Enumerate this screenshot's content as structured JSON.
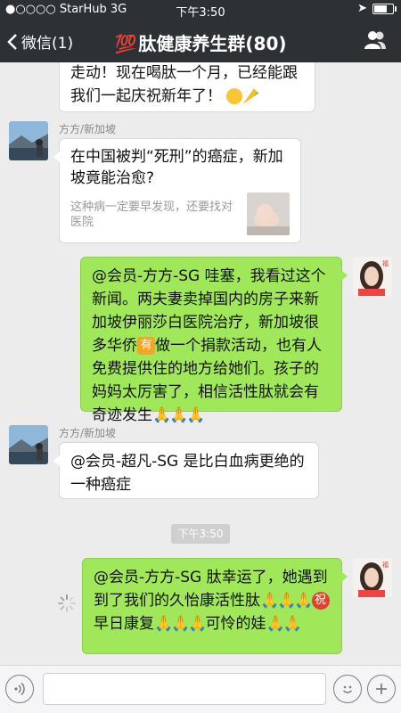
{
  "status_bar": {
    "carrier": "●○○○○ StarHub  3G",
    "time": "下午3:50"
  },
  "nav": {
    "back_label": "微信(1)",
    "title_emoji": "💯",
    "title": "肽健康养生群(80)"
  },
  "messages": [
    {
      "text": "走动！现在喝肽一个月，已经能跟我们一起庆祝新年了！"
    },
    {
      "sender": "方方/新加坡",
      "card_title": "在中国被判“死刑”的癌症，新加坡竟能治愈?",
      "card_desc": "这种病一定要早发现，还要找对医院"
    },
    {
      "text_1": "@会员-方方-SG 哇塞，我看过这个新闻。两夫妻卖掉国内的房子来新加坡伊丽莎白医院治疗，新加坡很多华侨",
      "emoji_have": "有",
      "text_2": "做一个捐款活动，也有人免费提供住的地方给她们。孩子的妈妈太厉害了，相信活性肽就会有奇迹发生",
      "pray": "🙏🙏🙏"
    },
    {
      "sender": "方方/新加坡",
      "text": "@会员-超凡-SG 是比白血病更绝的一种癌症"
    },
    {
      "text_1": "@会员-方方-SG 肽幸运了，她遇到到了我们的久怡康活性肽",
      "pray_1": "🙏🙏🙏",
      "emoji_bless": "祝",
      "text_2": "早日康复",
      "pray_2": "🙏🙏🙏",
      "text_3": "可怜的娃",
      "pray_3": "🙏🙏"
    }
  ],
  "timestamp": "下午3:50",
  "colors": {
    "nav_bg": "#2e3134",
    "chat_bg": "#ececec",
    "green_bubble": "#a0e75a",
    "accent_red": "#e0302b"
  },
  "icons": {
    "back": "chevron-left-icon",
    "members": "group-members-icon",
    "voice": "voice-icon",
    "emoji": "smiley-icon",
    "more": "plus-icon"
  }
}
